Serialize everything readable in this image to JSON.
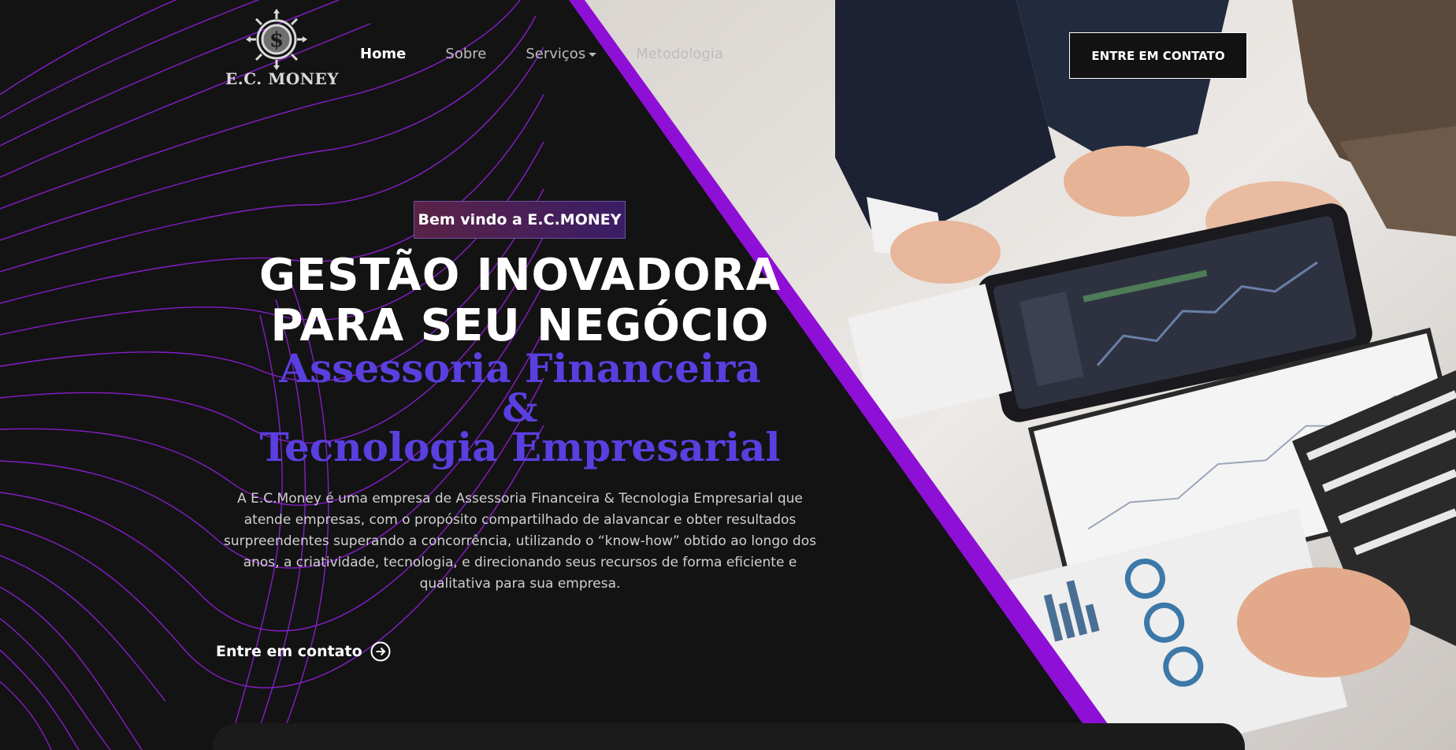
{
  "brand": {
    "name": "E.C. MONEY",
    "logo_icon": "dollar-coin-icon"
  },
  "nav": {
    "items": [
      {
        "label": "Home",
        "active": true
      },
      {
        "label": "Sobre",
        "active": false
      },
      {
        "label": "Serviços",
        "active": false,
        "dropdown": true
      },
      {
        "label": "Metodologia",
        "active": false
      }
    ],
    "contact_button": "ENTRE EM CONTATO"
  },
  "hero": {
    "badge": "Bem vindo a E.C.MONEY",
    "title_line1": "GESTÃO INOVADORA",
    "title_line2": "PARA SEU NEGÓCIO",
    "subtitle_line1": "Assessoria Financeira",
    "subtitle_line2": "&",
    "subtitle_line3": "Tecnologia Empresarial",
    "description": "A E.C.Money é uma empresa de Assessoria Financeira & Tecnologia Empresarial que atende empresas, com o propósito compartilhado de alavancar e obter resultados surpreendentes superando a concorrência, utilizando o “know-how” obtido ao longo dos anos, a criatividade, tecnologia, e direcionando seus recursos de forma eficiente e qualitativa para sua empresa.",
    "cta": "Entre em contato",
    "cta_icon": "arrow-right-circle-icon"
  },
  "colors": {
    "accent_purple": "#8e0fd6",
    "subtitle_blue": "#5a3fe0",
    "background": "#131313"
  }
}
